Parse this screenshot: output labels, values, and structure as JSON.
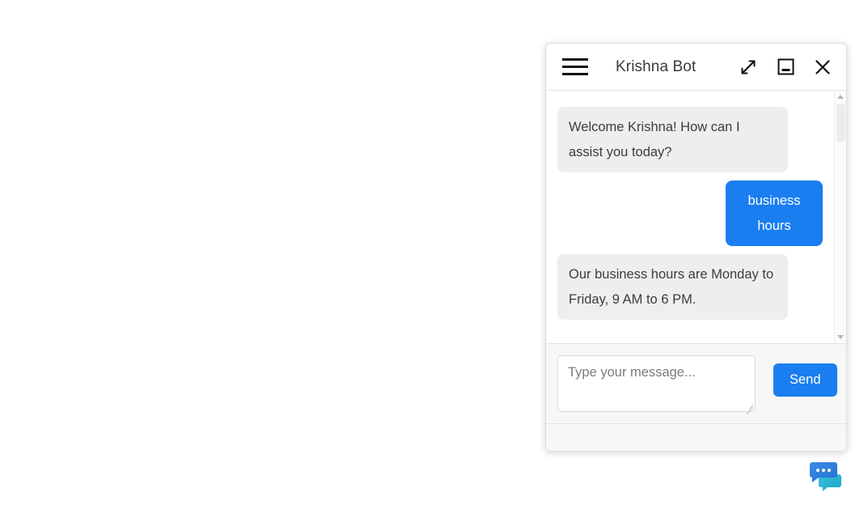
{
  "window": {
    "title": "Krishna Bot",
    "menu_icon": "hamburger-menu-icon",
    "expand_icon": "expand-diagonal-icon",
    "minimize_icon": "minimize-window-icon",
    "close_icon": "close-x-icon"
  },
  "messages": [
    {
      "sender": "bot",
      "text": "Welcome Krishna! How can I assist you today?"
    },
    {
      "sender": "user",
      "text": "business hours"
    },
    {
      "sender": "bot",
      "text": "Our business hours are Monday to Friday, 9 AM to 6 PM."
    }
  ],
  "input": {
    "placeholder": "Type your message...",
    "value": "",
    "send_label": "Send"
  },
  "scrollbar": {
    "up_arrow": "scroll-up-arrow-icon",
    "down_arrow": "scroll-down-arrow-icon"
  },
  "launcher": {
    "icon": "chat-bubbles-icon"
  },
  "colors": {
    "accent": "#1a7ef0",
    "bot_bubble": "#eeeeee",
    "bot_text": "#3c3c3c",
    "user_text": "#ffffff",
    "panel_bg": "#ffffff",
    "input_bg": "#f7f7f7",
    "launcher_primary": "#2f7fe0",
    "launcher_secondary": "#2bb5d8"
  }
}
